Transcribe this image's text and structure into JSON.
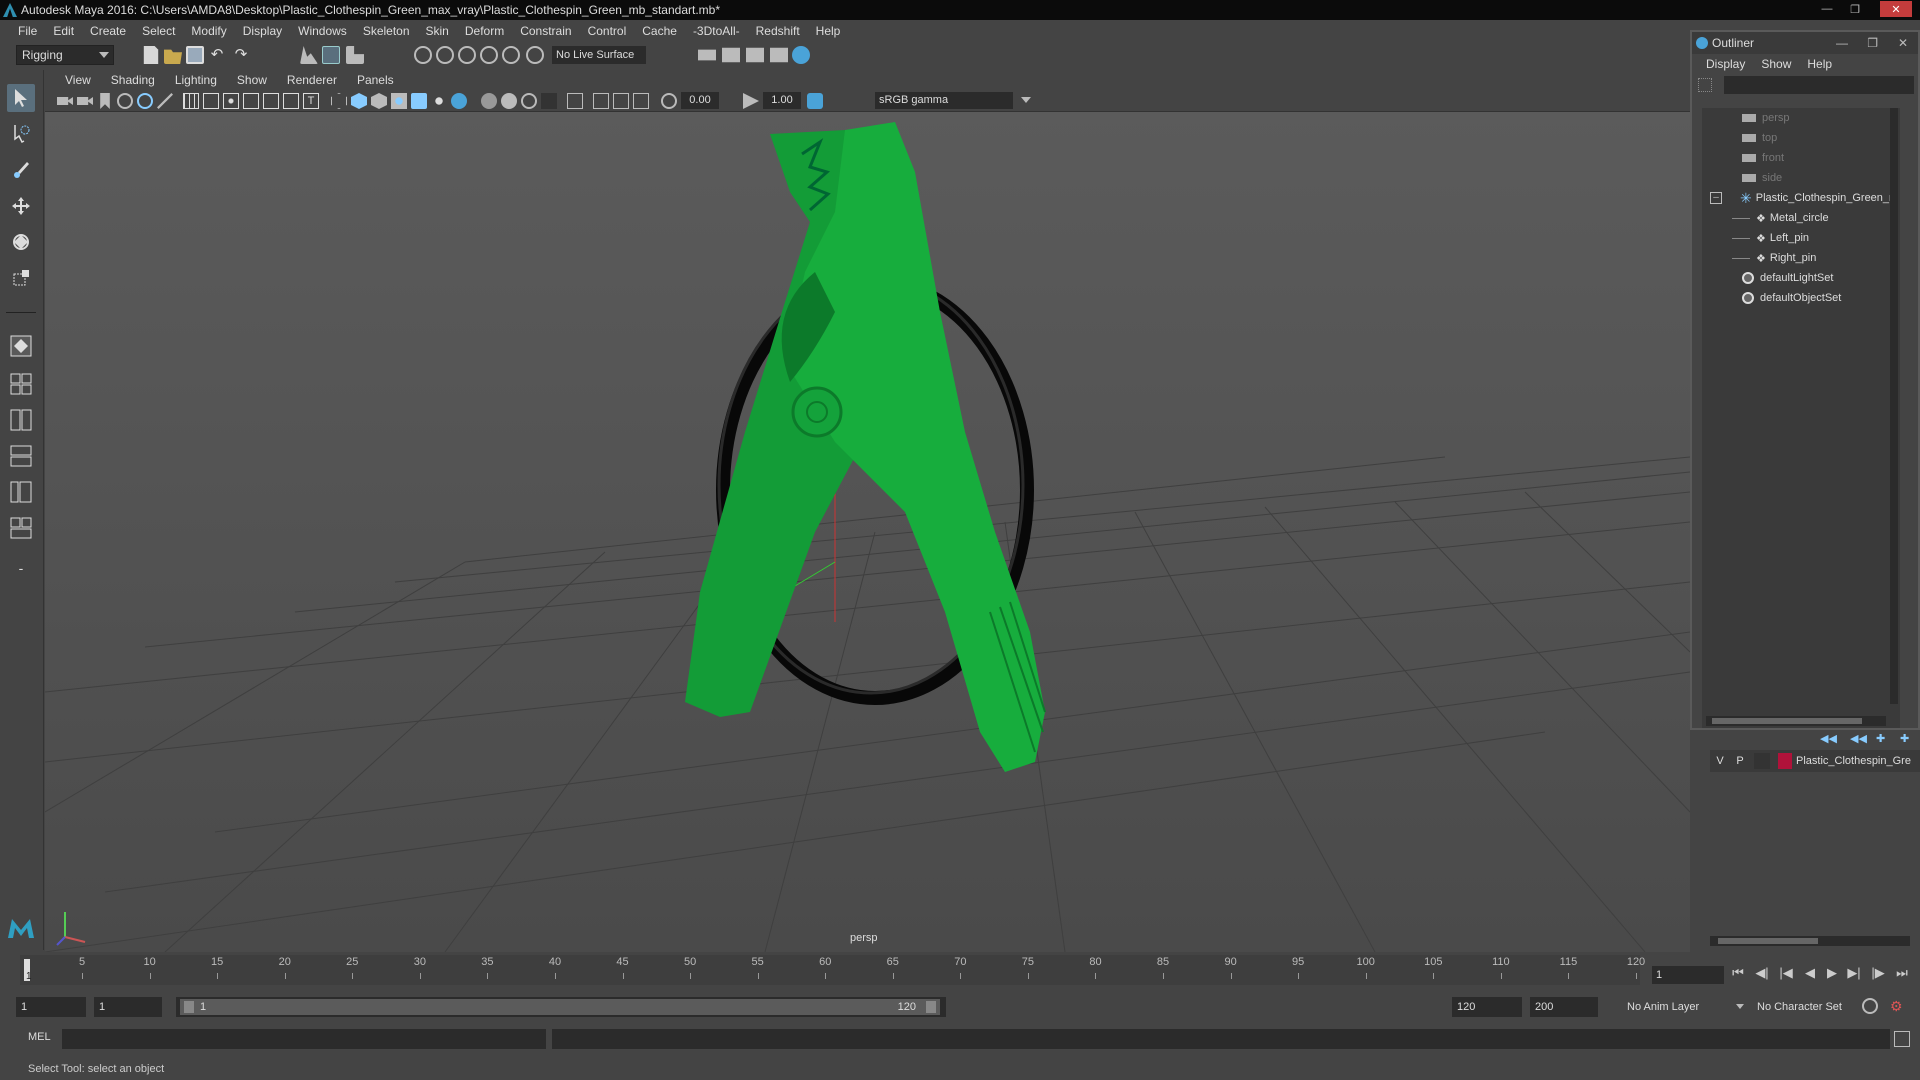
{
  "window": {
    "title": "Autodesk Maya 2016: C:\\Users\\AMDA8\\Desktop\\Plastic_Clothespin_Green_max_vray\\Plastic_Clothespin_Green_mb_standart.mb*"
  },
  "menubar": {
    "items": [
      "File",
      "Edit",
      "Create",
      "Select",
      "Modify",
      "Display",
      "Windows",
      "Skeleton",
      "Skin",
      "Deform",
      "Constrain",
      "Control",
      "Cache",
      "-3DtoAll-",
      "Redshift",
      "Help"
    ]
  },
  "statusline": {
    "mode": "Rigging",
    "live_surface": "No Live Surface"
  },
  "panel": {
    "menu": [
      "View",
      "Shading",
      "Lighting",
      "Show",
      "Renderer",
      "Panels"
    ],
    "exposure": "0.00",
    "gamma": "1.00",
    "color_space": "sRGB gamma",
    "camera_label": "persp"
  },
  "outliner": {
    "title": "Outliner",
    "menu": [
      "Display",
      "Show",
      "Help"
    ],
    "items": [
      {
        "label": "persp",
        "icon": "camera-icon",
        "dim": true
      },
      {
        "label": "top",
        "icon": "camera-icon",
        "dim": true
      },
      {
        "label": "front",
        "icon": "camera-icon",
        "dim": true
      },
      {
        "label": "side",
        "icon": "camera-icon",
        "dim": true
      },
      {
        "label": "Plastic_Clothespin_Green_n",
        "icon": "group-icon",
        "dim": false
      },
      {
        "label": "Metal_circle",
        "icon": "mesh-icon",
        "dim": false
      },
      {
        "label": "Left_pin",
        "icon": "mesh-icon",
        "dim": false
      },
      {
        "label": "Right_pin",
        "icon": "mesh-icon",
        "dim": false
      },
      {
        "label": "defaultLightSet",
        "icon": "set-icon",
        "dim": false
      },
      {
        "label": "defaultObjectSet",
        "icon": "set-icon",
        "dim": false
      }
    ]
  },
  "layers": {
    "row": {
      "v": "V",
      "p": "P",
      "name": "Plastic_Clothespin_Gre",
      "color": "#b0123a"
    }
  },
  "timeslider": {
    "ticks": [
      "5",
      "10",
      "15",
      "20",
      "25",
      "30",
      "35",
      "40",
      "45",
      "50",
      "55",
      "60",
      "65",
      "70",
      "75",
      "80",
      "85",
      "90",
      "95",
      "100",
      "105",
      "110",
      "115",
      "120"
    ],
    "start_marker": "1",
    "current_frame": "1"
  },
  "rangebar": {
    "start": "1",
    "playback_start": "1",
    "range_start_label": "1",
    "range_end_label": "120",
    "playback_end": "120",
    "end": "200",
    "anim_layer": "No Anim Layer",
    "character_set": "No Character Set"
  },
  "cmdline": {
    "label": "MEL"
  },
  "helpline": {
    "text": "Select Tool: select an object"
  },
  "colors": {
    "clothespin": "#16a23a",
    "ring": "#0a0a0a",
    "accent": "#5a6f7d"
  }
}
